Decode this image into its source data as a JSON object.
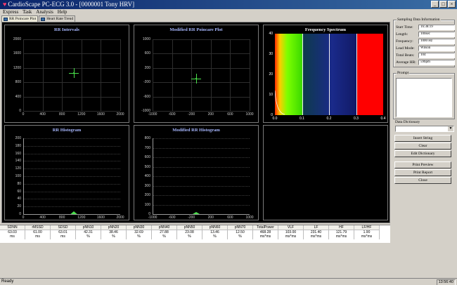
{
  "window": {
    "title": "CardioScape PC-ECG 3.0 - [0000001 Tony HRV]",
    "controls": [
      "_",
      "□",
      "×"
    ]
  },
  "menu": [
    "Express",
    "Task",
    "Analysis",
    "Help"
  ],
  "tabs": [
    {
      "label": "RR Poincare Plot",
      "active": true
    },
    {
      "label": "Heart Rate Trend",
      "active": false
    }
  ],
  "charts": {
    "rr_intervals": {
      "title": "RR Intervals",
      "y_ticks": [
        "2000",
        "1600",
        "1200",
        "800",
        "400",
        "0"
      ],
      "x_ticks": [
        "0",
        "400",
        "800",
        "1200",
        "1600",
        "2000"
      ]
    },
    "modified_poincare": {
      "title": "Modified RR Poincare Plot",
      "y_ticks": [
        "1000",
        "600",
        "200",
        "-200",
        "-600",
        "-1000"
      ],
      "x_ticks": [
        "-1000",
        "-600",
        "-200",
        "200",
        "600",
        "1000"
      ]
    },
    "frequency_spectrum": {
      "title": "Frequency Spectrum",
      "y_ticks": [
        "40",
        "30",
        "20",
        "10",
        "0"
      ],
      "x_ticks": [
        "0.0",
        "0.1",
        "0.2",
        "0.3",
        "0.4"
      ]
    },
    "rr_histogram": {
      "title": "RR Histogram",
      "y_ticks": [
        "200",
        "180",
        "160",
        "140",
        "120",
        "100",
        "80",
        "60",
        "40",
        "20",
        "0"
      ],
      "x_ticks": [
        "0",
        "400",
        "800",
        "1200",
        "1600",
        "2000"
      ]
    },
    "modified_rr_histogram": {
      "title": "Modified RR Histogram",
      "y_ticks": [
        "800",
        "700",
        "600",
        "500",
        "400",
        "300",
        "200",
        "100",
        "0"
      ],
      "x_ticks": [
        "-1000",
        "-600",
        "-200",
        "200",
        "600",
        "1000"
      ]
    }
  },
  "chart_data": [
    {
      "type": "scatter",
      "title": "RR Intervals",
      "x": [
        1050
      ],
      "y": [
        1050
      ],
      "xlim": [
        0,
        2000
      ],
      "ylim": [
        0,
        2000
      ],
      "grid": true
    },
    {
      "type": "scatter",
      "title": "Modified RR Poincare Plot",
      "x": [
        -100
      ],
      "y": [
        -100
      ],
      "xlim": [
        -1000,
        1000
      ],
      "ylim": [
        -1000,
        1000
      ],
      "grid": true
    },
    {
      "type": "area",
      "title": "Frequency Spectrum",
      "xlim": [
        0,
        0.4
      ],
      "ylim": [
        0,
        40
      ],
      "bands": [
        {
          "from": 0.0,
          "to": 0.1,
          "color": "#3ad900"
        },
        {
          "from": 0.1,
          "to": 0.3,
          "color": "#1a2a8a"
        },
        {
          "from": 0.3,
          "to": 0.4,
          "color": "#ff0000"
        }
      ]
    },
    {
      "type": "bar",
      "title": "RR Histogram",
      "xlim": [
        0,
        2000
      ],
      "ylim": [
        0,
        200
      ],
      "peak_x": 1050,
      "peak_y": 8
    },
    {
      "type": "bar",
      "title": "Modified RR Histogram",
      "xlim": [
        -1000,
        1000
      ],
      "ylim": [
        0,
        800
      ],
      "peak_x": -100,
      "peak_y": 10
    }
  ],
  "metrics": {
    "headers": [
      "SDNN",
      "rMSSD",
      "SDSD",
      "pNN10",
      "pNN20",
      "pNN30",
      "pNN40",
      "pNN50",
      "pNN60",
      "pNN70",
      "TotalPower",
      "VLF",
      "LF",
      "HF",
      "LF/HF"
    ],
    "values": [
      "63.03",
      "61.00",
      "63.01",
      "42.31",
      "38.46",
      "32.69",
      "27.88",
      "23.08",
      "13.46",
      "12.50",
      "468.28",
      "103.00",
      "231.40",
      "121.79",
      "1.90"
    ],
    "units": [
      "ms",
      "ms",
      "ms",
      "%",
      "%",
      "%",
      "%",
      "%",
      "%",
      "%",
      "ms*ms",
      "ms*ms",
      "ms*ms",
      "ms*ms",
      "ms*ms"
    ]
  },
  "sampling": {
    "group_title": "Sampling Data Information",
    "fields": [
      {
        "label": "Start Time:",
        "value": "16:38:19"
      },
      {
        "label": "Length:",
        "value": "100sec"
      },
      {
        "label": "Frequency:",
        "value": "1000 Hz"
      },
      {
        "label": "Lead Mode:",
        "value": "Wilson"
      },
      {
        "label": "Total Beats:",
        "value": "104"
      },
      {
        "label": "Average HR:",
        "value": "59bpm"
      }
    ]
  },
  "prompt": {
    "group_title": "Prompt",
    "text": ""
  },
  "dictionary": {
    "label": "Data Dictionary",
    "selected": "",
    "insert": "Insert String",
    "clear": "Clear",
    "edit": "Edit Dictionary"
  },
  "print": {
    "preview": "Print Preview",
    "report": "Print Report",
    "close": "Close"
  },
  "status": {
    "text": "Ready",
    "time": "13:56:40"
  },
  "colors": {
    "titlebar": "#0a246a",
    "chart_bg": "#000000",
    "marker": "#49e04a",
    "lf_band": "#3ad900",
    "hf_band": "#1a2a8a",
    "vhf_band": "#ff0000"
  }
}
